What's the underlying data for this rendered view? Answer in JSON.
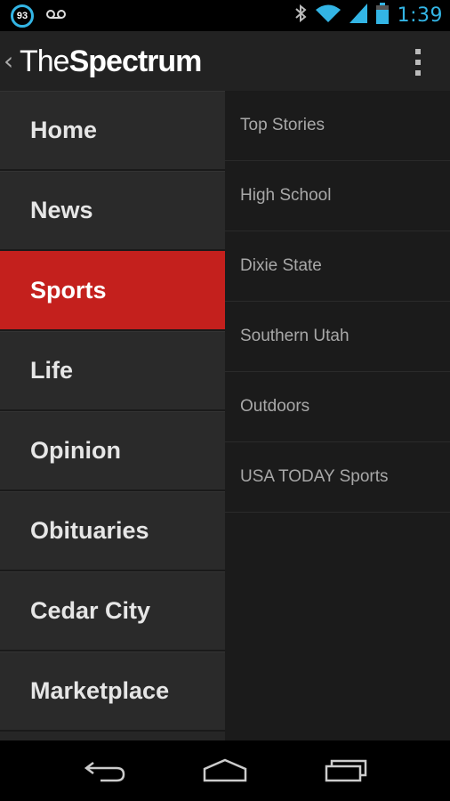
{
  "status_bar": {
    "notification_badge": "93",
    "clock": "1:39",
    "icons": [
      "notification-badge-icon",
      "voicemail-icon",
      "bluetooth-icon",
      "wifi-icon",
      "cell-signal-icon",
      "battery-icon"
    ],
    "accent_color": "#33b5e5"
  },
  "action_bar": {
    "logo_the": "The",
    "logo_spectrum": "Spectrum",
    "icons": [
      "up-caret-icon",
      "overflow-menu-icon"
    ]
  },
  "left_menu": {
    "active_color": "#c4201d",
    "items": [
      {
        "label": "Home"
      },
      {
        "label": "News"
      },
      {
        "label": "Sports"
      },
      {
        "label": "Life"
      },
      {
        "label": "Opinion"
      },
      {
        "label": "Obituaries"
      },
      {
        "label": "Cedar City"
      },
      {
        "label": "Marketplace"
      }
    ]
  },
  "sub_menu": {
    "items": [
      {
        "label": "Top Stories"
      },
      {
        "label": "High School"
      },
      {
        "label": "Dixie State"
      },
      {
        "label": "Southern Utah"
      },
      {
        "label": "Outdoors"
      },
      {
        "label": "USA TODAY Sports"
      }
    ]
  },
  "nav_bar": {
    "icons": [
      "back-icon",
      "home-icon",
      "recent-apps-icon"
    ]
  }
}
